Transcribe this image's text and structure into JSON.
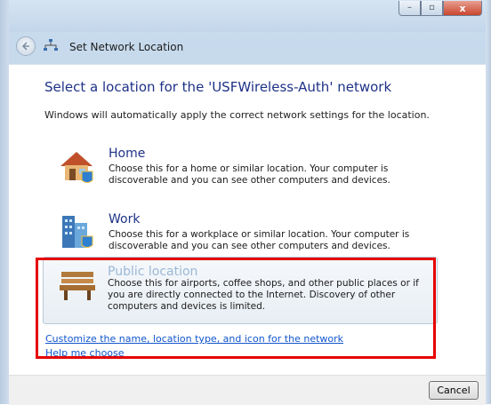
{
  "window": {
    "title": "Set Network Location",
    "caption_buttons": {
      "minimize": "–",
      "maximize": "▫",
      "close": "x"
    }
  },
  "main": {
    "heading": "Select a location for the 'USFWireless-Auth' network",
    "intro": "Windows will automatically apply the correct network settings for the location.",
    "options": [
      {
        "title": "Home",
        "description": "Choose this for a home or similar location. Your computer is discoverable and you can see other computers and devices.",
        "icon": "home-icon"
      },
      {
        "title": "Work",
        "description": "Choose this for a workplace or similar location. Your computer is discoverable and you can see other computers and devices.",
        "icon": "work-icon"
      },
      {
        "title": "Public location",
        "description": "Choose this for airports, coffee shops, and other public places or if you are directly connected to the Internet. Discovery of other computers and devices is limited.",
        "icon": "bench-icon"
      }
    ],
    "links": {
      "customize": "Customize the name, location type, and icon for the network",
      "help": "Help me choose"
    }
  },
  "footer": {
    "cancel_label": "Cancel"
  },
  "colors": {
    "heading": "#1e3287",
    "link": "#1155cc",
    "highlight": "#e60000"
  }
}
